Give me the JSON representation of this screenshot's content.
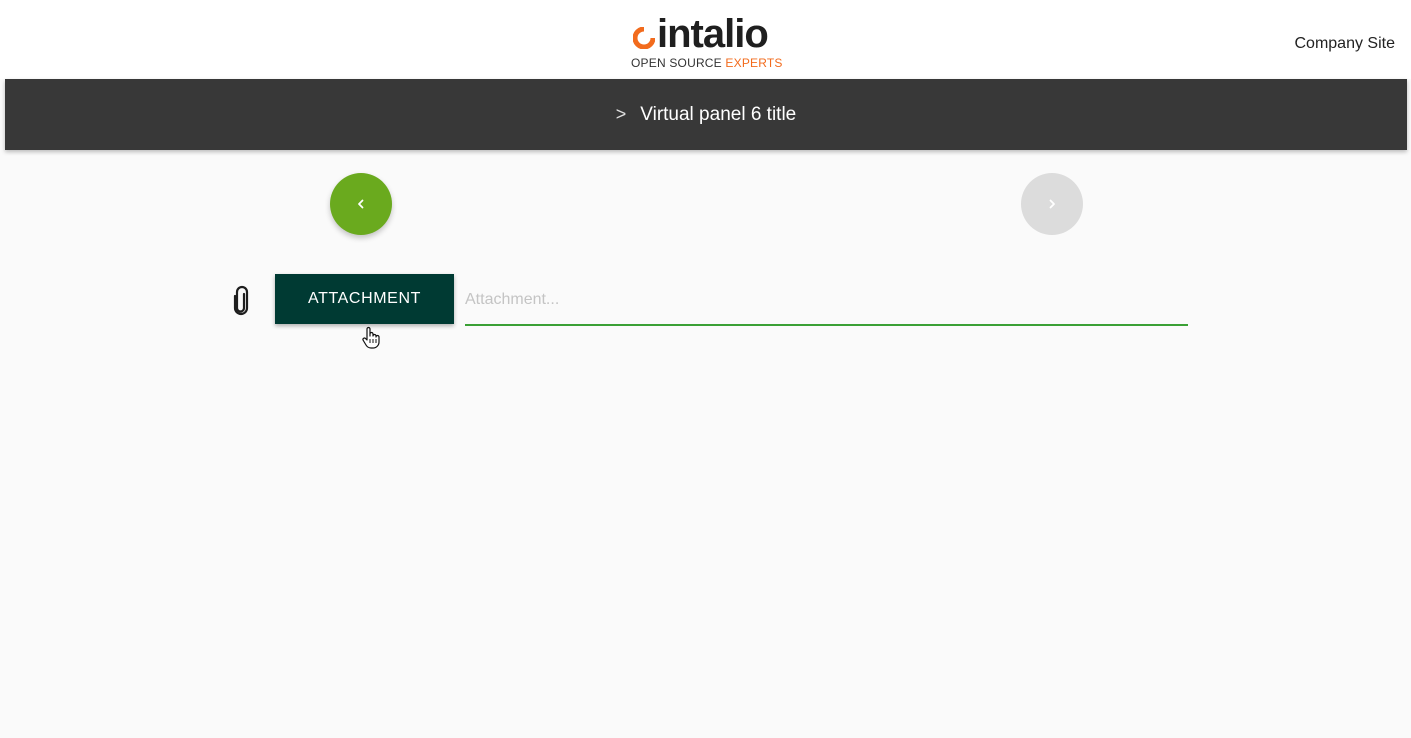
{
  "header": {
    "logo": {
      "word": "intalio",
      "tagline_part1": "OPEN SOURCE ",
      "tagline_part2": "EXPERTS",
      "brand_orange": "#f26b1d"
    },
    "company_link": "Company Site"
  },
  "titlebar": {
    "chevron": ">",
    "title": "Virtual panel 6 title",
    "background": "#383838"
  },
  "navigation": {
    "prev_icon": "chevron-left-icon",
    "next_icon": "chevron-right-icon",
    "prev_color": "#6aaa1e",
    "next_color": "#dcdcdc"
  },
  "attachment": {
    "icon": "paperclip-icon",
    "button_label": "ATTACHMENT",
    "input_value": "",
    "input_placeholder": "Attachment...",
    "button_color": "#003a33",
    "underline_color": "#3aa035"
  }
}
